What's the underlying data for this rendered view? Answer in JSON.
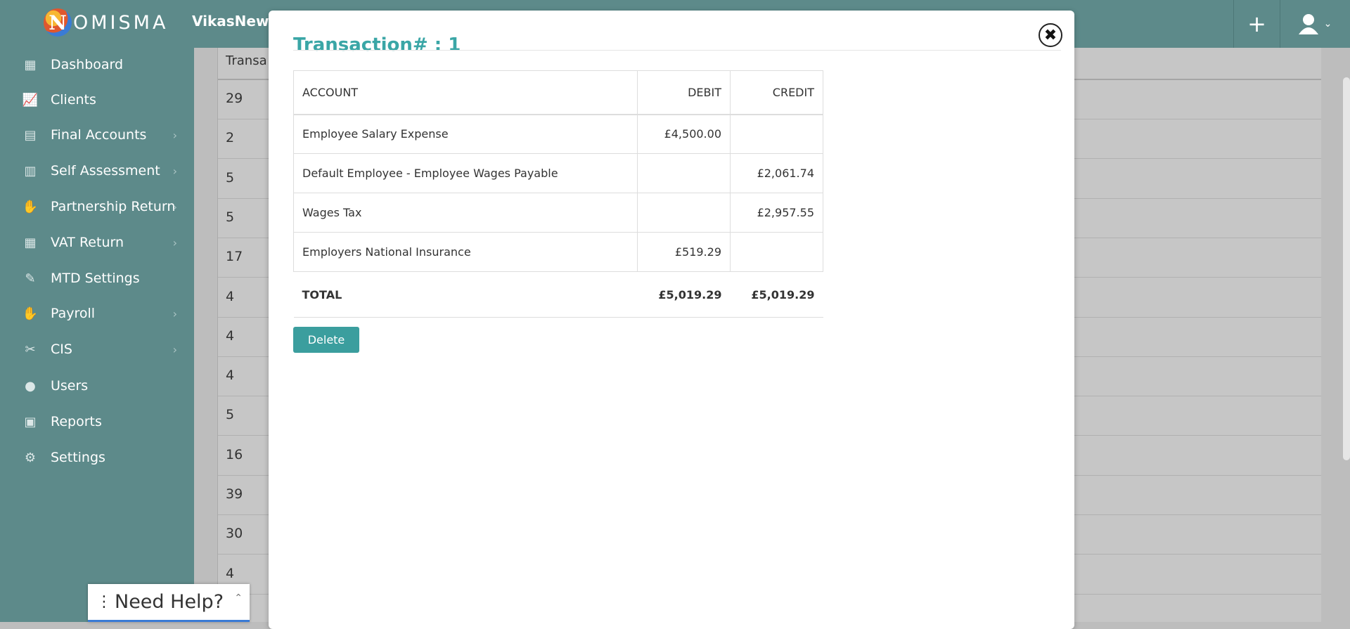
{
  "header": {
    "logo_letter": "N",
    "logo_text": "OMISMA",
    "company_name": "VikasNew",
    "add_icon": "plus-icon",
    "user_icon": "user-icon"
  },
  "sidebar": {
    "items": [
      {
        "label": "Dashboard",
        "icon": "dashboard-icon",
        "glyph": "▦",
        "arrow": false
      },
      {
        "label": "Clients",
        "icon": "chart-icon",
        "glyph": "📈",
        "arrow": false
      },
      {
        "label": "Final Accounts",
        "icon": "ledger-icon",
        "glyph": "▤",
        "arrow": true
      },
      {
        "label": "Self Assessment",
        "icon": "form-icon",
        "glyph": "▥",
        "arrow": true
      },
      {
        "label": "Partnership Return",
        "icon": "handshake-icon",
        "glyph": "✋",
        "arrow": true
      },
      {
        "label": "VAT Return",
        "icon": "calculator-icon",
        "glyph": "▦",
        "arrow": true
      },
      {
        "label": "MTD Settings",
        "icon": "tag-icon",
        "glyph": "✎",
        "arrow": false
      },
      {
        "label": "Payroll",
        "icon": "payroll-icon",
        "glyph": "✋",
        "arrow": true
      },
      {
        "label": "CIS",
        "icon": "tools-icon",
        "glyph": "✂",
        "arrow": true
      },
      {
        "label": "Users",
        "icon": "user-icon",
        "glyph": "●",
        "arrow": false
      },
      {
        "label": "Reports",
        "icon": "clipboard-icon",
        "glyph": "▣",
        "arrow": false
      },
      {
        "label": "Settings",
        "icon": "gear-icon",
        "glyph": "⚙",
        "arrow": false
      }
    ]
  },
  "background_table": {
    "header": "Transa",
    "rows": [
      "29",
      "2",
      "5",
      "5",
      "17",
      "4",
      "4",
      "4",
      "5",
      "16",
      "39",
      "30",
      "4"
    ]
  },
  "modal": {
    "title": "Transaction# : 1",
    "columns": {
      "account": "ACCOUNT",
      "debit": "DEBIT",
      "credit": "CREDIT"
    },
    "rows": [
      {
        "account": "Employee Salary Expense",
        "debit": "£4,500.00",
        "credit": ""
      },
      {
        "account": "Default Employee - Employee Wages Payable",
        "debit": "",
        "credit": "£2,061.74"
      },
      {
        "account": "Wages Tax",
        "debit": "",
        "credit": "£2,957.55"
      },
      {
        "account": "Employers National Insurance",
        "debit": "£519.29",
        "credit": ""
      }
    ],
    "total": {
      "label": "TOTAL",
      "debit": "£5,019.29",
      "credit": "£5,019.29"
    },
    "delete_label": "Delete"
  },
  "help": {
    "label": "Need Help?"
  }
}
